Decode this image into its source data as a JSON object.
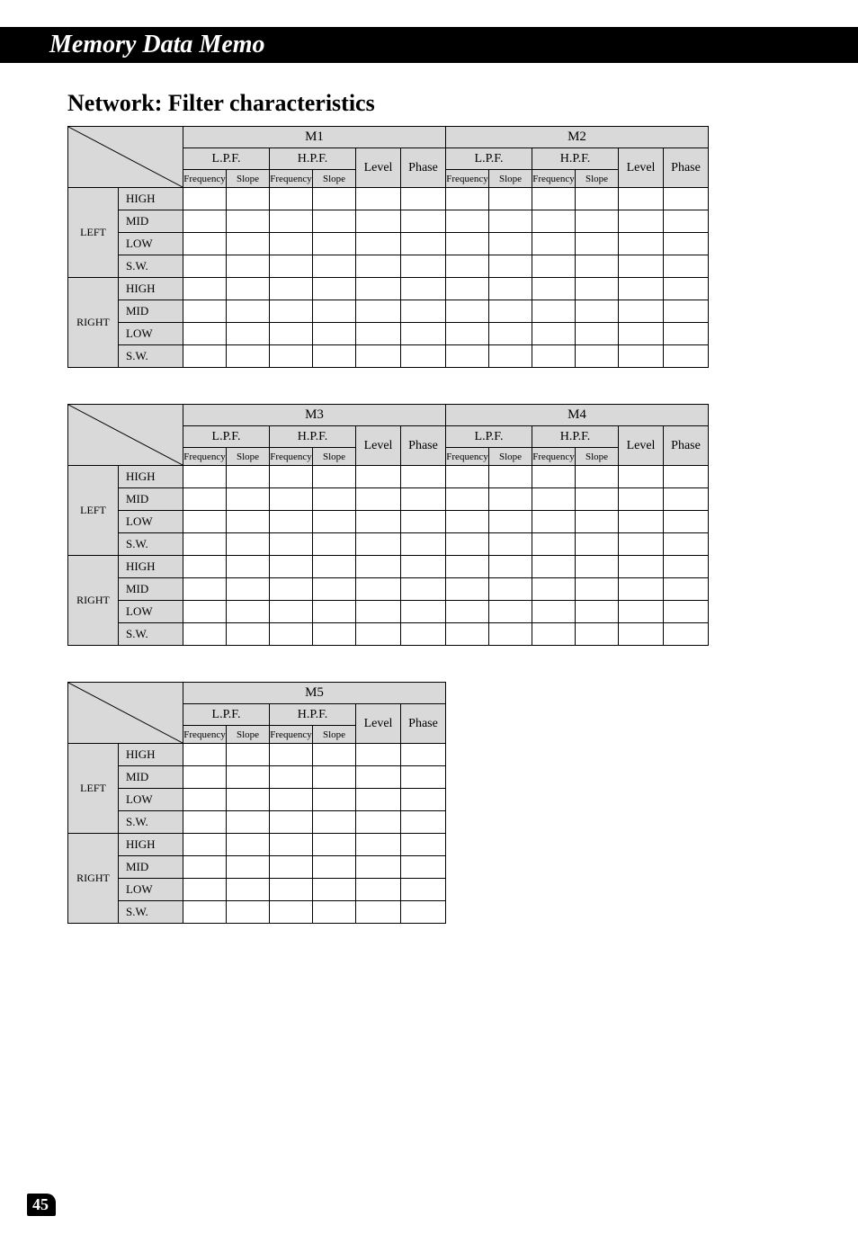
{
  "banner": "Memory Data Memo",
  "section_title": "Network: Filter characteristics",
  "labels": {
    "lpf": "L.P.F.",
    "hpf": "H.P.F.",
    "level": "Level",
    "phase": "Phase",
    "frequency": "Frequency",
    "slope": "Slope",
    "left": "LEFT",
    "right": "RIGHT",
    "high": "HIGH",
    "mid": "MID",
    "low": "LOW",
    "sw": "S.W."
  },
  "tables": [
    {
      "memories": [
        "M1",
        "M2"
      ]
    },
    {
      "memories": [
        "M3",
        "M4"
      ]
    },
    {
      "memories": [
        "M5"
      ]
    }
  ],
  "page_number": "45"
}
